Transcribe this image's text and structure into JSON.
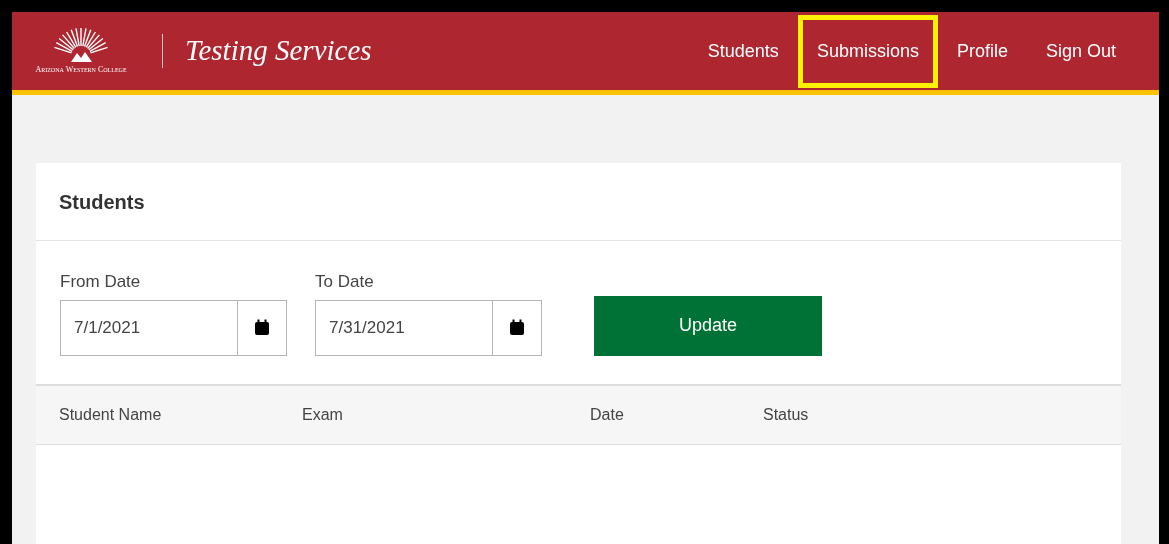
{
  "header": {
    "logo_text": "Arizona Western College",
    "title": "Testing Services"
  },
  "nav": [
    {
      "label": "Students",
      "highlighted": false
    },
    {
      "label": "Submissions",
      "highlighted": true
    },
    {
      "label": "Profile",
      "highlighted": false
    },
    {
      "label": "Sign Out",
      "highlighted": false
    }
  ],
  "panel": {
    "title": "Students",
    "filters": [
      {
        "label": "From Date",
        "value": "7/1/2021"
      },
      {
        "label": "To Date",
        "value": "7/31/2021"
      }
    ],
    "button": "Update",
    "table": {
      "columns": [
        "Student Name",
        "Exam",
        "Date",
        "Status"
      ]
    }
  }
}
